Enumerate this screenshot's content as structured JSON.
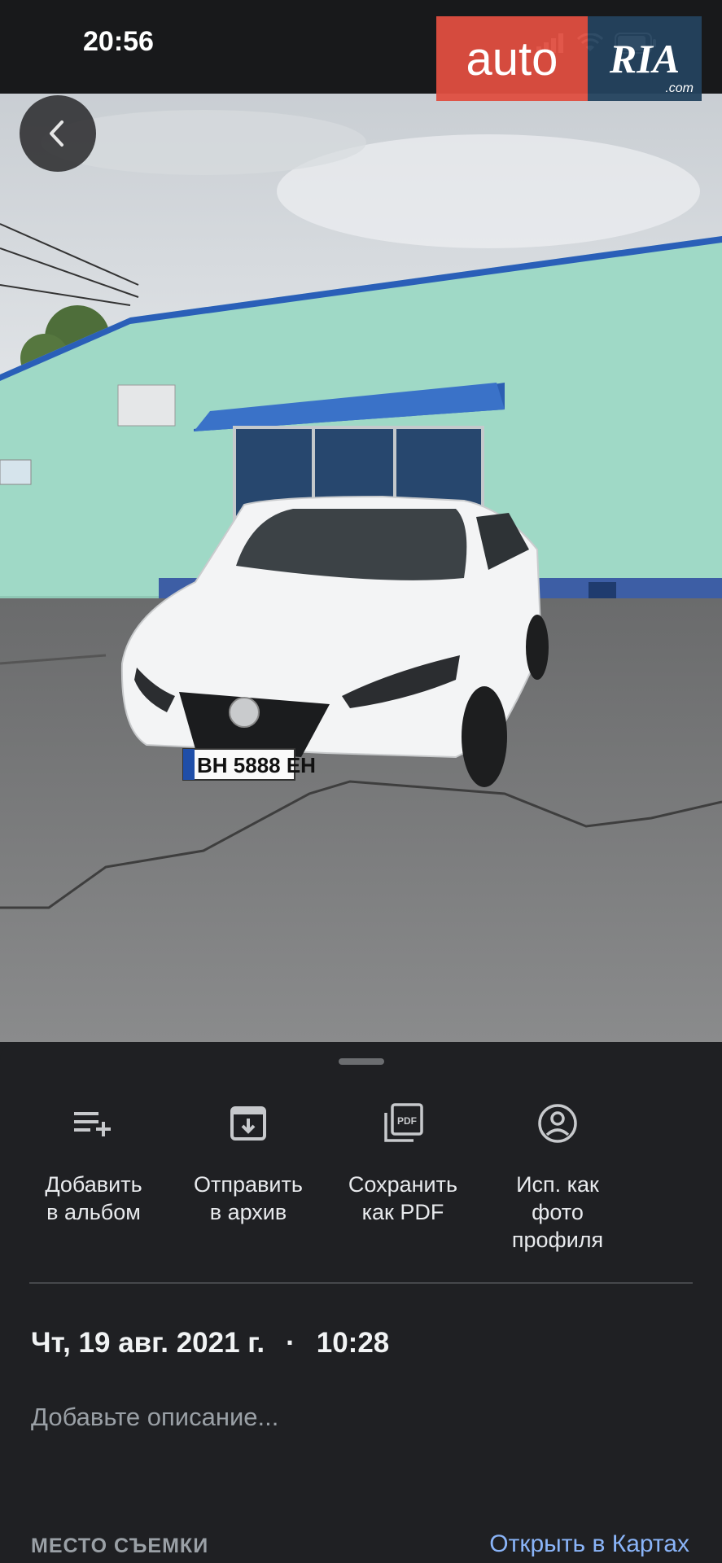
{
  "status_bar": {
    "time": "20:56"
  },
  "watermark": {
    "auto": "auto",
    "ria": "RIA",
    "com": ".com",
    "colors": {
      "auto_bg": "#df4e40",
      "ria_bg": "#24425e"
    }
  },
  "photo": {
    "subject_icon": "car-photo",
    "plate": "BH 5888 EH"
  },
  "sheet": {
    "actions": [
      {
        "icon": "playlist-add-icon",
        "label": "Добавить\nв альбом"
      },
      {
        "icon": "archive-icon",
        "label": "Отправить\nв архив"
      },
      {
        "icon": "pdf-icon",
        "label": "Сохранить\nкак PDF"
      },
      {
        "icon": "account-circle-icon",
        "label": "Исп. как\nфото\nпрофиля"
      }
    ],
    "date": "Чт, 19 авг. 2021 г.",
    "separator": "·",
    "time": "10:28",
    "description_placeholder": "Добавьте описание...",
    "place_label": "МЕСТО СЪЕМКИ",
    "maps_link": "Открыть в Картах"
  }
}
